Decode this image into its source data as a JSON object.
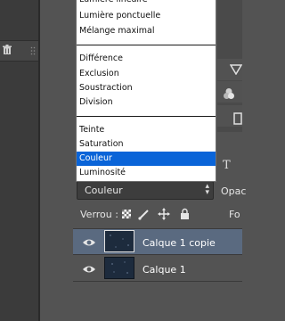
{
  "blend_menu": {
    "groups": [
      [
        "Lumière linéaire",
        "Lumière ponctuelle",
        "Mélange maximal"
      ],
      [
        "Différence",
        "Exclusion",
        "Soustraction",
        "Division"
      ],
      [
        "Teinte",
        "Saturation",
        "Couleur",
        "Luminosité"
      ]
    ],
    "selected": "Couleur",
    "selection_color": "#0a64d8"
  },
  "layers_panel": {
    "blend_mode_value": "Couleur",
    "opacity_label": "Opac",
    "lock_label": "Verrou :",
    "fill_label": "Fo",
    "type_filter_icon": "T",
    "lock_icons": [
      "lock-transparent-pixels-icon",
      "lock-image-pixels-icon",
      "lock-position-icon",
      "lock-all-icon"
    ],
    "layers": [
      {
        "name": "Calque 1 copie",
        "visible": true,
        "selected": true
      },
      {
        "name": "Calque 1",
        "visible": true,
        "selected": false
      }
    ],
    "selected_row_color": "#5a6a80"
  },
  "left_panel": {
    "icons": [
      "trash-icon",
      "panel-grip-icon"
    ]
  }
}
